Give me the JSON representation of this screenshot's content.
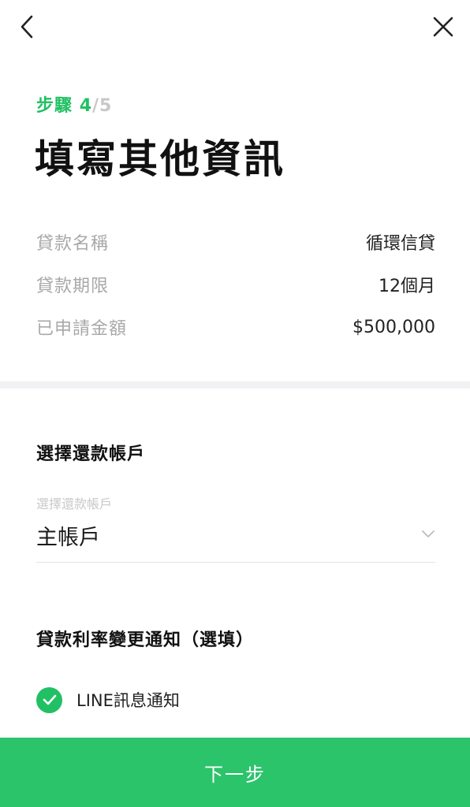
{
  "header": {
    "back_icon": "chevron-left-icon",
    "close_icon": "close-icon"
  },
  "step": {
    "label": "步驟",
    "current": "4",
    "separator": "/",
    "total": "5"
  },
  "title": "填寫其他資訊",
  "loan_info": [
    {
      "key": "貸款名稱",
      "value": "循環信貸"
    },
    {
      "key": "貸款期限",
      "value": "12個月"
    },
    {
      "key": "已申請金額",
      "value": "$500,000"
    }
  ],
  "repayment": {
    "section_title": "選擇還款帳戶",
    "placeholder": "選擇還款帳戶",
    "selected": "主帳戶"
  },
  "notification": {
    "section_title": "貸款利率變更通知（選填）",
    "option_label": "LINE訊息通知",
    "checked": true
  },
  "footer": {
    "next_label": "下一步"
  },
  "colors": {
    "accent": "#22c064",
    "button": "#2bc46b",
    "muted": "#a8a8a8"
  }
}
